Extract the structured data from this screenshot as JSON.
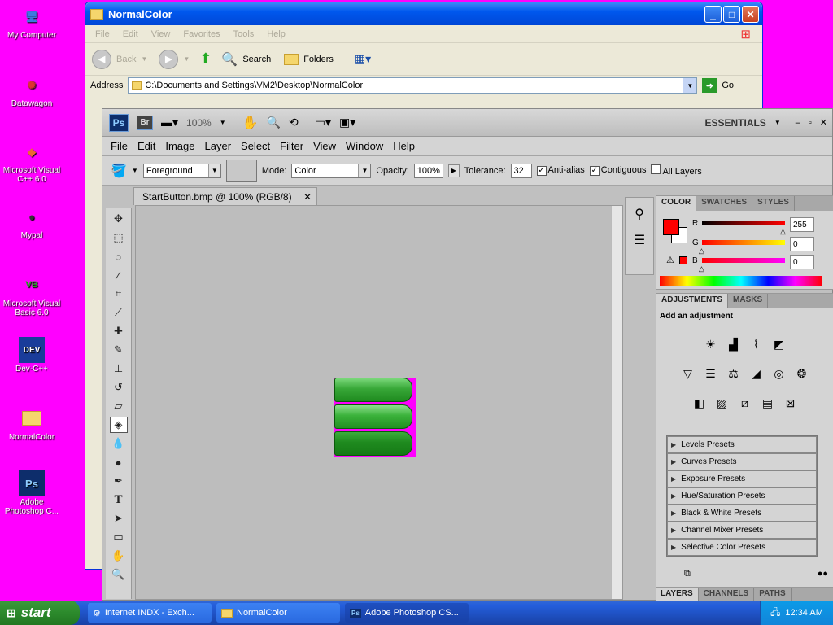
{
  "desktop": {
    "icons": [
      {
        "label_1": "My Computer",
        "label_2": ""
      },
      {
        "label_1": "Datawagon",
        "label_2": ""
      },
      {
        "label_1": "Microsoft Visual",
        "label_2": "C++ 6.0"
      },
      {
        "label_1": "Mypal",
        "label_2": ""
      },
      {
        "label_1": "Microsoft Visual",
        "label_2": "Basic 6.0"
      },
      {
        "label_1": "Dev-C++",
        "label_2": ""
      },
      {
        "label_1": "NormalColor",
        "label_2": ""
      },
      {
        "label_1": "Adobe",
        "label_2": "Photoshop C..."
      }
    ]
  },
  "explorer": {
    "title": "NormalColor",
    "menu": [
      "File",
      "Edit",
      "View",
      "Favorites",
      "Tools",
      "Help"
    ],
    "toolbar": {
      "back": "Back",
      "search": "Search",
      "folders": "Folders"
    },
    "address_label": "Address",
    "address": "C:\\Documents and Settings\\VM2\\Desktop\\NormalColor",
    "go": "Go"
  },
  "photoshop": {
    "app_logo": "Ps",
    "bridge": "Br",
    "zoom": "100%",
    "workspace": "ESSENTIALS",
    "menu": [
      "File",
      "Edit",
      "Image",
      "Layer",
      "Select",
      "Filter",
      "View",
      "Window",
      "Help"
    ],
    "options": {
      "fill": "Foreground",
      "mode_label": "Mode:",
      "mode": "Color",
      "opacity_label": "Opacity:",
      "opacity": "100%",
      "tolerance_label": "Tolerance:",
      "tolerance": "32",
      "antialias": "Anti-alias",
      "contiguous": "Contiguous",
      "all_layers": "All Layers"
    },
    "doc_tab": "StartButton.bmp @ 100% (RGB/8)",
    "color_panel": {
      "tabs": [
        "COLOR",
        "SWATCHES",
        "STYLES"
      ],
      "r_label": "R",
      "g_label": "G",
      "b_label": "B",
      "r": "255",
      "g": "0",
      "b": "0",
      "foreground": "#ff0000",
      "background": "#ffffff",
      "r_level": 1.0,
      "g_level": 0.0,
      "b_level": 0.0
    },
    "adjust_panel": {
      "tabs": [
        "ADJUSTMENTS",
        "MASKS"
      ],
      "heading": "Add an adjustment",
      "presets": [
        "Levels Presets",
        "Curves Presets",
        "Exposure Presets",
        "Hue/Saturation Presets",
        "Black & White Presets",
        "Channel Mixer Presets",
        "Selective Color Presets"
      ]
    },
    "layers_tabs": [
      "LAYERS",
      "CHANNELS",
      "PATHS"
    ]
  },
  "taskbar": {
    "start": "start",
    "tasks": [
      "Internet INDX - Exch...",
      "NormalColor",
      "Adobe Photoshop CS..."
    ],
    "clock": "12:34 AM"
  }
}
